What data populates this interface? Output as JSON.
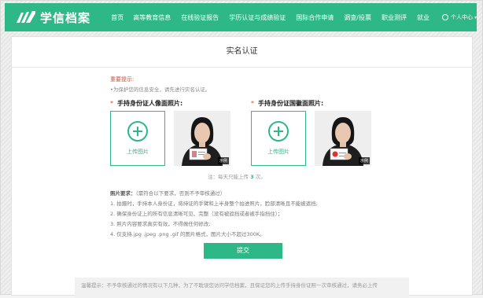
{
  "header": {
    "site_name": "学信档案",
    "brand_color": "#2fb887",
    "menu": [
      "首页",
      "高等教育信息",
      "在线验证报告",
      "学历认证与成绩验证",
      "国际合作申请",
      "调查/投票",
      "职业测评",
      "就业"
    ],
    "user_center": "个人中心"
  },
  "page": {
    "title": "实名认证",
    "notice_title": "重要提示:",
    "notice_line": "为保护您的信息安全，请先进行实名认证。"
  },
  "uploads": [
    {
      "label": "手持身份证人像面照片:",
      "button": "上传图片",
      "sample_badge": "示例"
    },
    {
      "label": "手持身份证国徽面照片:",
      "button": "上传图片",
      "sample_badge": "示例"
    }
  ],
  "limit": {
    "prefix": "注：每天只能上传",
    "count": "3",
    "suffix": "次。"
  },
  "requirements": {
    "title": "照片要求：",
    "title_note": "（需符合以下要求，否则不予审核通过）",
    "items": [
      "1. 拍摄时，手持本人身份证，将持证的手臂和上半身整个拍进照片，脸部清晰且不能被遮挡;",
      "2. 确保身份证上的所有信息清晰可见、完整（没有被遮挡或者被手指挡住）；",
      "3. 照片内容要求真实有效，不得做任何修改;",
      "4. 仅支持.jpg .jpeg .png .gif 的图片格式，图片大小不超过300K。"
    ]
  },
  "submit_label": "提交",
  "footer_note": "温馨提示：不予审核通过的情况有以下几种，为了不耽误您访问学信档案，且保证您的上传手持身份证照一次审核通过，请务必上传"
}
